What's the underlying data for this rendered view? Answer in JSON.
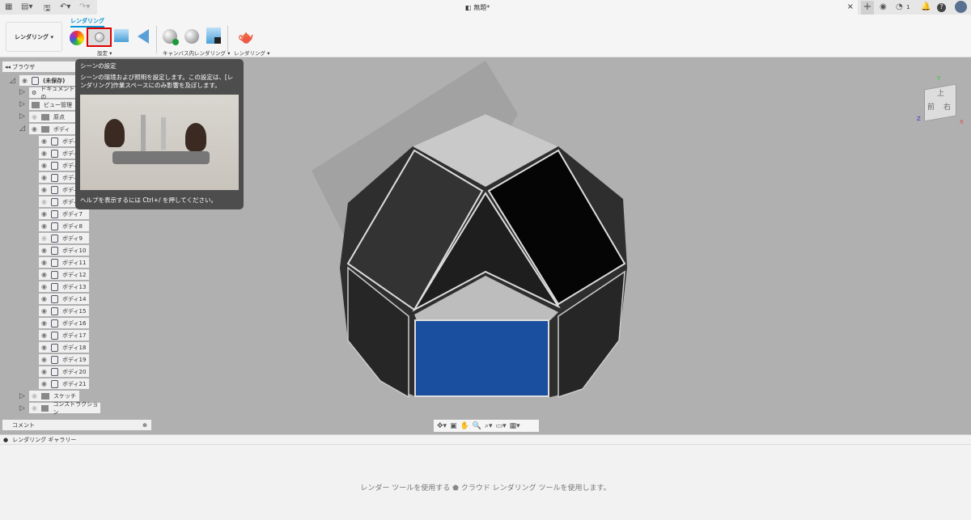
{
  "window": {
    "title": "無題*",
    "notifications": "1"
  },
  "toolbar": {
    "workspace": "レンダリング",
    "active_tab": "レンダリング",
    "groups": [
      {
        "label": "設定"
      },
      {
        "label": "キャンバス内レンダリング"
      },
      {
        "label": "レンダリング"
      }
    ]
  },
  "browser": {
    "title": "ブラウザ",
    "root": "(未保存)",
    "nodes": [
      "ドキュメントの",
      "ビュー管理",
      "原点",
      "ボディ"
    ],
    "bodies": [
      "ボディ",
      "ボディ",
      "ボディ",
      "ボディ",
      "ボディ",
      "ボディ",
      "ボディ7",
      "ボディ8",
      "ボディ9",
      "ボディ10",
      "ボディ11",
      "ボディ12",
      "ボディ13",
      "ボディ14",
      "ボディ15",
      "ボディ16",
      "ボディ17",
      "ボディ18",
      "ボディ19",
      "ボディ20",
      "ボディ21"
    ],
    "sketch": "スケッチ",
    "construction": "コンストラクション"
  },
  "tooltip": {
    "title": "シーンの設定",
    "description": "シーンの環境および照明を設定します。この設定は、[レンダリング]作業スペースにのみ影響を及ぼします。",
    "help": "ヘルプを表示するには Ctrl+/ を押してください。"
  },
  "viewcube": {
    "top": "上",
    "front": "前",
    "right": "右",
    "x": "X",
    "y": "Y",
    "z": "Z"
  },
  "comments": {
    "label": "コメント"
  },
  "gallery": {
    "title": "レンダリング ギャラリー",
    "message_pre": "レンダー ツールを使用する",
    "message_post": "クラウド レンダリング ツールを使用します。"
  },
  "colors": {
    "accent": "#0696d7",
    "highlight": "#e00000",
    "blue_face": "#1a4fa0"
  }
}
